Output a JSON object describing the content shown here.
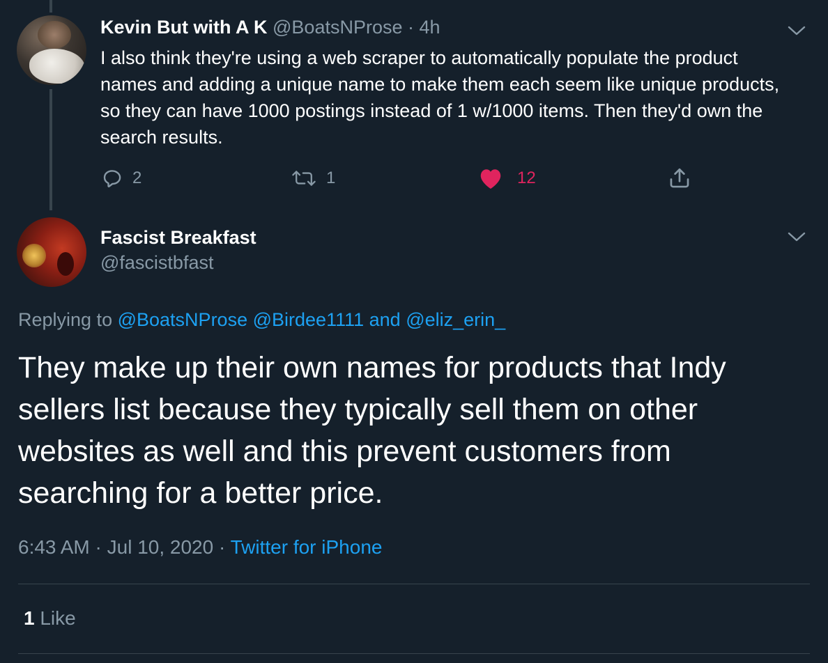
{
  "colors": {
    "background": "#15202b",
    "text_primary": "#ffffff",
    "text_secondary": "#8899a6",
    "link": "#1da1f2",
    "like": "#e0245e",
    "divider": "#38444d"
  },
  "parent_tweet": {
    "author_name": "Kevin But with A K",
    "author_handle": "@BoatsNProse",
    "separator": "·",
    "time_ago": "4h",
    "text": "I also think they're using a web scraper to automatically populate the product names and adding a unique name to make them each seem like unique products, so they can have 1000 postings instead of 1 w/1000 items. Then they'd own the search results.",
    "actions": {
      "reply": {
        "icon": "reply-icon",
        "count": "2"
      },
      "retweet": {
        "icon": "retweet-icon",
        "count": "1"
      },
      "like": {
        "icon": "heart-filled-icon",
        "count": "12"
      },
      "share": {
        "icon": "share-icon"
      }
    }
  },
  "main_tweet": {
    "author_name": "Fascist Breakfast",
    "author_handle": "@fascistbfast",
    "replying_prefix": "Replying to",
    "replying_to": [
      "@BoatsNProse",
      "@Birdee1111"
    ],
    "replying_and": "and",
    "replying_last": "@eliz_erin_",
    "text": "They make up their own names for products that Indy sellers list because they typically sell them on other websites as well and this prevent customers from searching for a better price.",
    "time": "6:43 AM",
    "date": "Jul 10, 2020",
    "separator": "·",
    "source": "Twitter for iPhone",
    "likes_count": "1",
    "likes_label": "Like"
  }
}
